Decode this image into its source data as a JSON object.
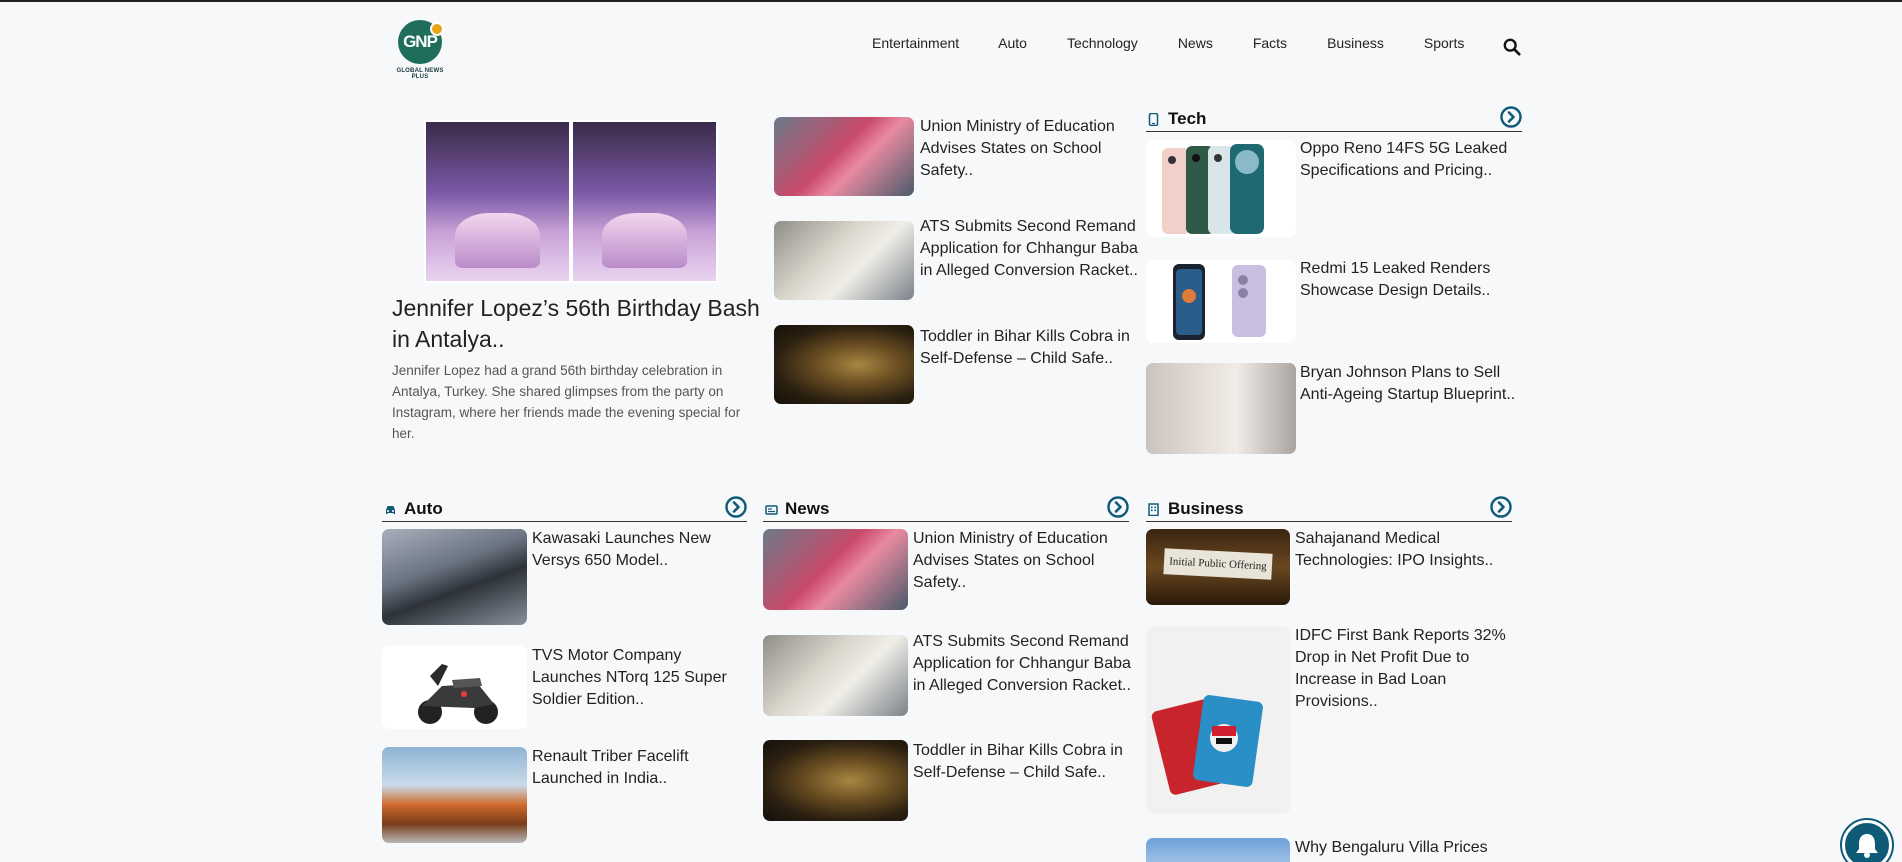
{
  "header": {
    "logo_text": "GNP",
    "logo_subtitle": "GLOBAL NEWS PLUS",
    "nav": [
      "Entertainment",
      "Auto",
      "Technology",
      "News",
      "Facts",
      "Business",
      "Sports"
    ]
  },
  "featured": {
    "title": "Jennifer Lopez’s 56th Birthday Bash in Antalya..",
    "description": "Jennifer Lopez had a grand 56th birthday celebration in Antalya, Turkey. She shared glimpses from the party on Instagram, where her friends made the evening special for her."
  },
  "top_list": [
    {
      "title": "Union Ministry of Education Advises States on School Safety.."
    },
    {
      "title": "ATS Submits Second Remand Application for Chhangur Baba in Alleged Conversion Racket.."
    },
    {
      "title": "Toddler in Bihar Kills Cobra in Self-Defense – Child Safe.."
    }
  ],
  "tech": {
    "heading": "Tech",
    "items": [
      {
        "title": "Oppo Reno 14FS 5G Leaked Specifications and Pricing.."
      },
      {
        "title": "Redmi 15 Leaked Renders Showcase Design Details.."
      },
      {
        "title": "Bryan Johnson Plans to Sell Anti-Ageing Startup Blueprint.."
      }
    ]
  },
  "auto": {
    "heading": "Auto",
    "items": [
      {
        "title": "Kawasaki Launches New Versys 650 Model.."
      },
      {
        "title": "TVS Motor Company Launches NTorq 125 Super Soldier Edition.."
      },
      {
        "title": "Renault Triber Facelift Launched in India.."
      }
    ]
  },
  "news": {
    "heading": "News",
    "items": [
      {
        "title": "Union Ministry of Education Advises States on School Safety.."
      },
      {
        "title": "ATS Submits Second Remand Application for Chhangur Baba in Alleged Conversion Racket.."
      },
      {
        "title": "Toddler in Bihar Kills Cobra in Self-Defense – Child Safe.."
      }
    ]
  },
  "business": {
    "heading": "Business",
    "ipo_image_text": "Initial Public Offering",
    "items": [
      {
        "title": "Sahajanand Medical Technologies: IPO Insights.."
      },
      {
        "title": "IDFC First Bank Reports 32% Drop in Net Profit Due to Increase in Bad Loan Provisions.."
      },
      {
        "title": "Why Bengaluru Villa Prices"
      }
    ]
  },
  "colors": {
    "accent": "#0f5a77",
    "text": "#222222",
    "background": "#f7f8fa"
  }
}
